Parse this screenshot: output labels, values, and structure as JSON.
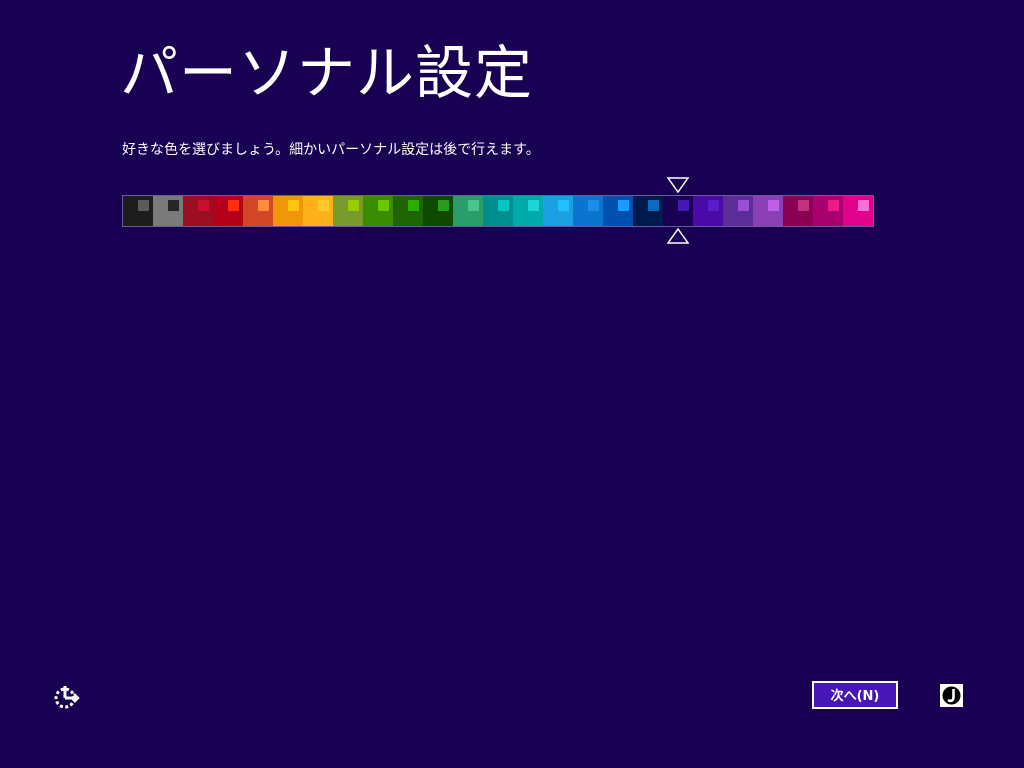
{
  "page": {
    "title": "パーソナル設定",
    "subtitle": "好きな色を選びましょう。細かいパーソナル設定は後で行えます。",
    "background_color": "#180052"
  },
  "color_picker": {
    "selected_index": 18,
    "swatches": [
      {
        "bg": "#1d1d1d",
        "accent": "#5a5a5a"
      },
      {
        "bg": "#7a7a7a",
        "accent": "#262626"
      },
      {
        "bg": "#9b0f22",
        "accent": "#c8102e"
      },
      {
        "bg": "#b4001a",
        "accent": "#ff2e12"
      },
      {
        "bg": "#d24726",
        "accent": "#ff8c3c"
      },
      {
        "bg": "#f09609",
        "accent": "#ffc40d"
      },
      {
        "bg": "#ffb11b",
        "accent": "#ffc929"
      },
      {
        "bg": "#7a9a2e",
        "accent": "#99cc00"
      },
      {
        "bg": "#3b8d00",
        "accent": "#6dc700"
      },
      {
        "bg": "#1e6400",
        "accent": "#2eab00"
      },
      {
        "bg": "#0d4a00",
        "accent": "#2a9c1a"
      },
      {
        "bg": "#2a9d6a",
        "accent": "#4ac48c"
      },
      {
        "bg": "#008e8e",
        "accent": "#00c6c6"
      },
      {
        "bg": "#00aaaa",
        "accent": "#1ad6d6"
      },
      {
        "bg": "#1ba1e2",
        "accent": "#23bfff"
      },
      {
        "bg": "#0a74cf",
        "accent": "#1b8ee8"
      },
      {
        "bg": "#0050b0",
        "accent": "#1a9cff"
      },
      {
        "bg": "#001a4d",
        "accent": "#0a6bbf"
      },
      {
        "bg": "#180052",
        "accent": "#4617b4"
      },
      {
        "bg": "#4a0aa6",
        "accent": "#5a1ec8"
      },
      {
        "bg": "#5a2e96",
        "accent": "#9b4fd6"
      },
      {
        "bg": "#8a3fb4",
        "accent": "#c05fe8"
      },
      {
        "bg": "#8a0053",
        "accent": "#c2307e"
      },
      {
        "bg": "#a8006e",
        "accent": "#ef1a8a"
      },
      {
        "bg": "#e3008c",
        "accent": "#ff6ed9"
      }
    ]
  },
  "icons": {
    "ease_of_access": "ease-of-access-icon",
    "ime": "ime-mode-icon",
    "marker_top": "triangle-down-icon",
    "marker_bottom": "triangle-up-icon"
  },
  "buttons": {
    "next_label": "次へ(N)"
  }
}
